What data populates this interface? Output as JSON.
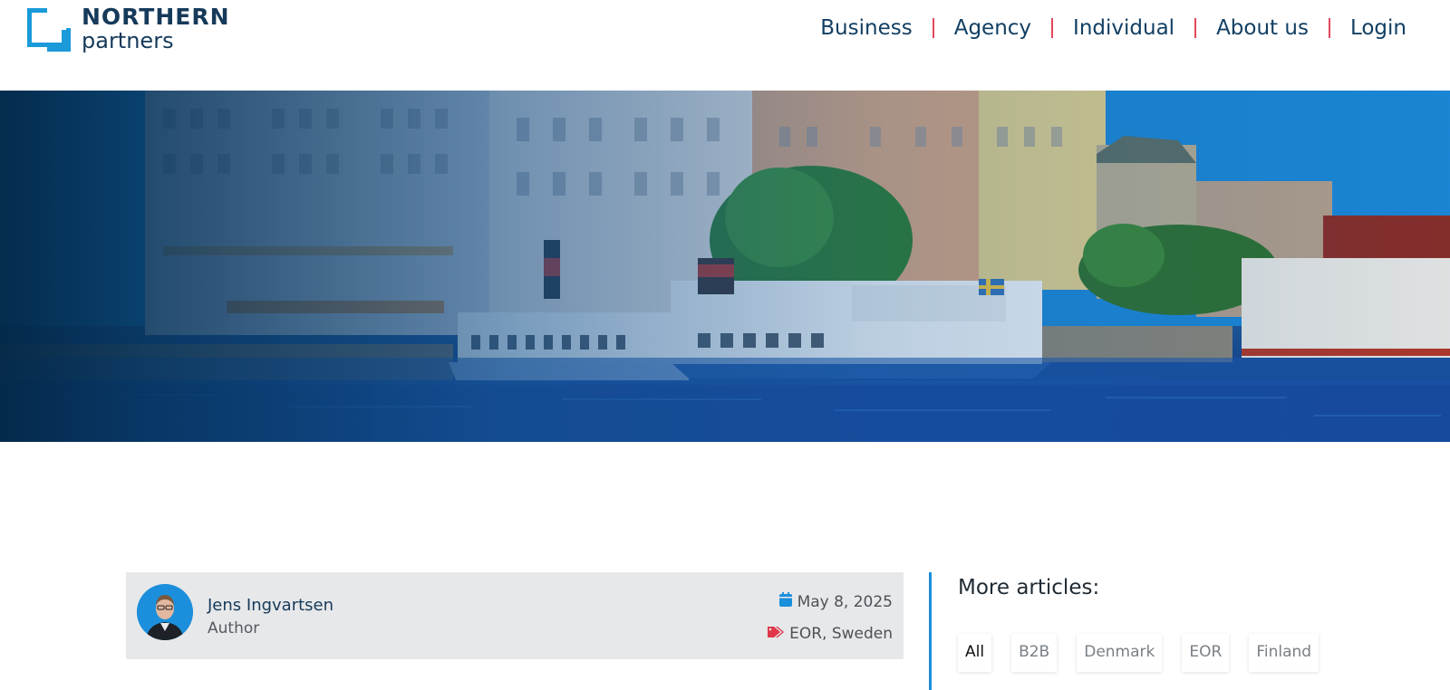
{
  "brand": {
    "line1": "NORTHERN",
    "line2": "partners",
    "accent": "#1a9ad9"
  },
  "nav": {
    "items": [
      "Business",
      "Agency",
      "Individual",
      "About us",
      "Login"
    ],
    "separator_color": "#e0485a"
  },
  "hero": {
    "image": "stockholm-harbor-boats",
    "flag_names": [
      "swedish-flag"
    ]
  },
  "author_card": {
    "name": "Jens Ingvartsen",
    "role": "Author",
    "date": "May 8, 2025",
    "tags": "EOR, Sweden",
    "date_icon": "calendar-icon",
    "tag_icon": "tag-icon"
  },
  "more_articles": {
    "title": "More articles:",
    "filters": [
      "All",
      "B2B",
      "Denmark",
      "EOR",
      "Finland"
    ],
    "active_filter": "All"
  }
}
